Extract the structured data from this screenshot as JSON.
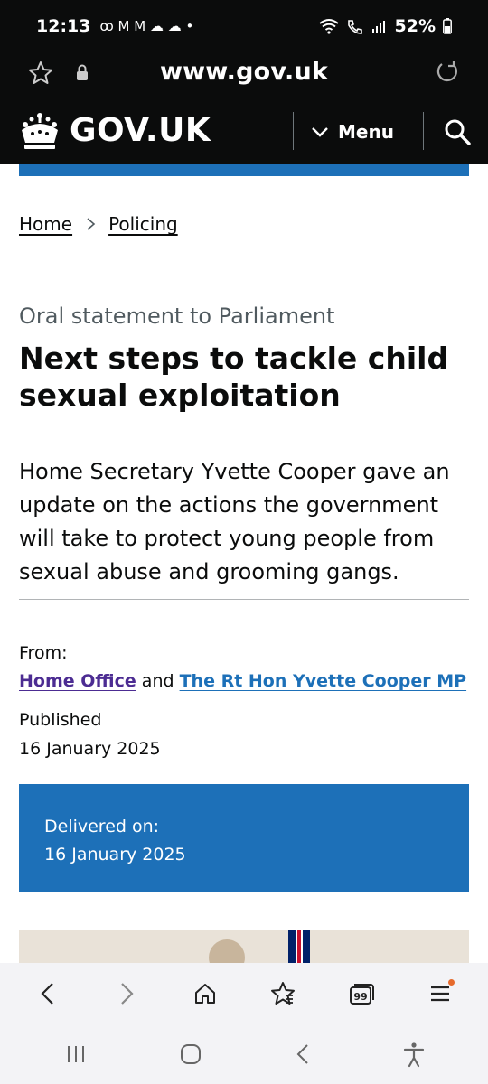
{
  "status_bar": {
    "time": "12:13",
    "notif_icons": "ꝏ M M ☁ ☁ •",
    "battery": "52%"
  },
  "browser": {
    "url": "www.gov.uk"
  },
  "header": {
    "logo_text": "GOV.UK",
    "menu_label": "Menu"
  },
  "breadcrumbs": [
    {
      "label": "Home"
    },
    {
      "label": "Policing"
    }
  ],
  "article": {
    "caption": "Oral statement to Parliament",
    "title": "Next steps to tackle child sexual exploitation",
    "lead": "Home Secretary Yvette Cooper gave an update on the actions the government will take to protect young people from sexual abuse and grooming gangs.",
    "from_label": "From:",
    "from_link_1": "Home Office",
    "from_and": "and",
    "from_link_2": "The Rt Hon Yvette Cooper MP",
    "published_label": "Published",
    "published_date": "16 January 2025",
    "delivered_label": "Delivered on:",
    "delivered_date": "16 January 2025"
  },
  "colors": {
    "header_bg": "#0b0c0c",
    "brand_blue": "#1d70b8",
    "visited_link": "#4c2c92",
    "secondary_text": "#505a5f"
  },
  "icons": {
    "toolbar": [
      "back-icon",
      "forward-icon",
      "home-icon",
      "bookmark-star-icon",
      "tabs-icon",
      "hamburger-menu-icon"
    ],
    "tabs_count": "99",
    "system_nav": [
      "recents-icon",
      "home-circle-icon",
      "back-chevron-icon",
      "accessibility-icon"
    ]
  }
}
